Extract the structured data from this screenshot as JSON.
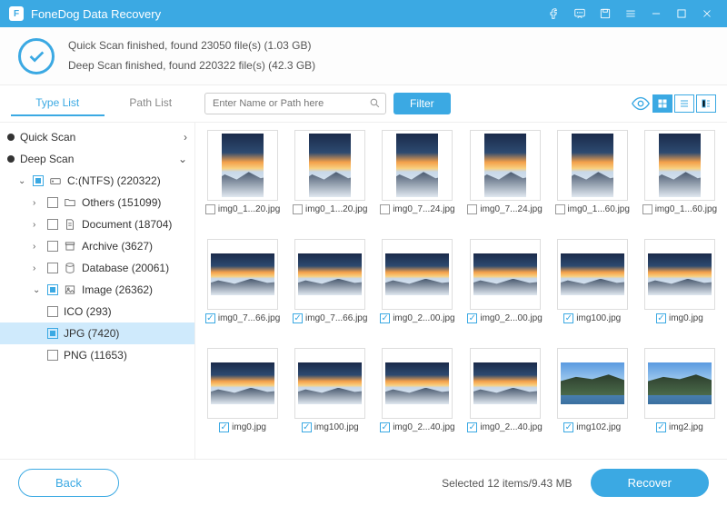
{
  "app": {
    "title": "FoneDog Data Recovery"
  },
  "status": {
    "line1": "Quick Scan finished, found 23050 file(s) (1.03 GB)",
    "line2": "Deep Scan finished, found 220322 file(s) (42.3 GB)"
  },
  "tabs": {
    "type": "Type List",
    "path": "Path List"
  },
  "search": {
    "placeholder": "Enter Name or Path here"
  },
  "filter": "Filter",
  "tree": {
    "quick": "Quick Scan",
    "deep": "Deep Scan",
    "drive": "C:(NTFS) (220322)",
    "others": "Others (151099)",
    "document": "Document (18704)",
    "archive": "Archive (3627)",
    "database": "Database (20061)",
    "image": "Image (26362)",
    "ico": "ICO (293)",
    "jpg": "JPG (7420)",
    "png": "PNG (11653)"
  },
  "files": [
    {
      "name": "img0_1...20.jpg",
      "checked": false,
      "v": "tall"
    },
    {
      "name": "img0_1...20.jpg",
      "checked": false,
      "v": "tall"
    },
    {
      "name": "img0_7...24.jpg",
      "checked": false,
      "v": "tall"
    },
    {
      "name": "img0_7...24.jpg",
      "checked": false,
      "v": "tall"
    },
    {
      "name": "img0_1...60.jpg",
      "checked": false,
      "v": "tall"
    },
    {
      "name": "img0_1...60.jpg",
      "checked": false,
      "v": "tall"
    },
    {
      "name": "img0_7...66.jpg",
      "checked": true,
      "v": "wide"
    },
    {
      "name": "img0_7...66.jpg",
      "checked": true,
      "v": "wide"
    },
    {
      "name": "img0_2...00.jpg",
      "checked": true,
      "v": "wide"
    },
    {
      "name": "img0_2...00.jpg",
      "checked": true,
      "v": "wide"
    },
    {
      "name": "img100.jpg",
      "checked": true,
      "v": "wide"
    },
    {
      "name": "img0.jpg",
      "checked": true,
      "v": "wide"
    },
    {
      "name": "img0.jpg",
      "checked": true,
      "v": "wide"
    },
    {
      "name": "img100.jpg",
      "checked": true,
      "v": "wide"
    },
    {
      "name": "img0_2...40.jpg",
      "checked": true,
      "v": "wide"
    },
    {
      "name": "img0_2...40.jpg",
      "checked": true,
      "v": "wide"
    },
    {
      "name": "img102.jpg",
      "checked": true,
      "v": "island"
    },
    {
      "name": "img2.jpg",
      "checked": true,
      "v": "island"
    }
  ],
  "footer": {
    "back": "Back",
    "selected": "Selected 12 items/9.43 MB",
    "recover": "Recover"
  }
}
